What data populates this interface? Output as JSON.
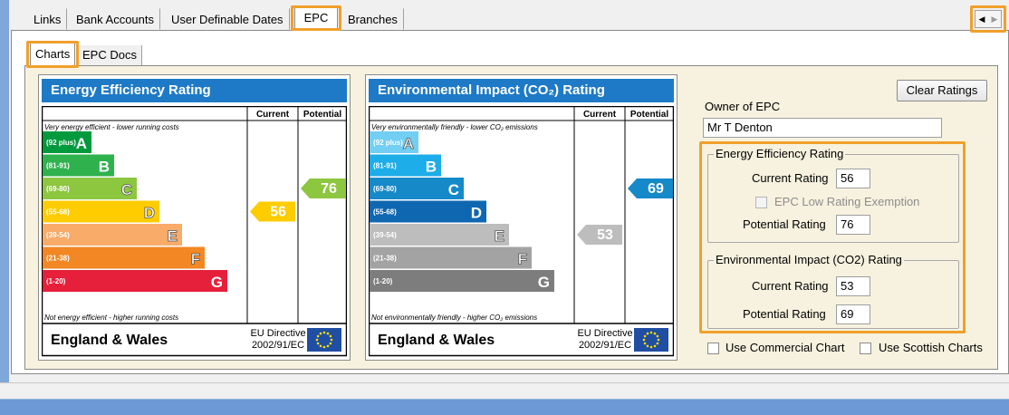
{
  "tabs": [
    "Links",
    "Bank Accounts",
    "User Definable Dates",
    "EPC",
    "Branches"
  ],
  "sub_tabs": [
    "Charts",
    "EPC Docs"
  ],
  "colors": {
    "band_A": "#009a3e",
    "band_B": "#2fb24e",
    "band_C": "#8dc63f",
    "band_D": "#ffcc00",
    "band_E": "#f9ab6a",
    "band_F": "#f28724",
    "band_G": "#e61f3b",
    "env_A": "#72cef2",
    "env_B": "#1dade8",
    "env_C": "#1689c9",
    "env_D": "#0f67b1",
    "env_E": "#bdbdbd",
    "env_F": "#a3a3a3",
    "env_G": "#7d7d7d",
    "title_bar": "#1e7ac6",
    "highlight": "#f0a02c"
  },
  "charts": [
    {
      "title": "Energy Efficiency Rating",
      "col_current": "Current",
      "col_potential": "Potential",
      "top_note": "Very energy efficient - lower running costs",
      "bottom_note": "Not energy efficient - higher running costs",
      "footer_region": "England & Wales",
      "directive_line1": "EU Directive",
      "directive_line2": "2002/91/EC",
      "bands": [
        {
          "range": "(92 plus)",
          "letter": "A",
          "color": "#009a3e"
        },
        {
          "range": "(81-91)",
          "letter": "B",
          "color": "#2fb24e"
        },
        {
          "range": "(69-80)",
          "letter": "C",
          "color": "#8dc63f"
        },
        {
          "range": "(55-68)",
          "letter": "D",
          "color": "#ffcc00"
        },
        {
          "range": "(39-54)",
          "letter": "E",
          "color": "#f9ab6a"
        },
        {
          "range": "(21-38)",
          "letter": "F",
          "color": "#f28724"
        },
        {
          "range": "(1-20)",
          "letter": "G",
          "color": "#e61f3b"
        }
      ],
      "current": {
        "value": 56,
        "band": "D",
        "color": "#ffcc00"
      },
      "potential": {
        "value": 76,
        "band": "C",
        "color": "#8dc63f"
      }
    },
    {
      "title": "Environmental Impact (CO₂) Rating",
      "col_current": "Current",
      "col_potential": "Potential",
      "top_note": "Very environmentally friendly - lower CO₂ emissions",
      "bottom_note": "Not environmentally friendly - higher CO₂ emissions",
      "footer_region": "England & Wales",
      "directive_line1": "EU Directive",
      "directive_line2": "2002/91/EC",
      "bands": [
        {
          "range": "(92 plus)",
          "letter": "A",
          "color": "#72cef2"
        },
        {
          "range": "(81-91)",
          "letter": "B",
          "color": "#1dade8"
        },
        {
          "range": "(69-80)",
          "letter": "C",
          "color": "#1689c9"
        },
        {
          "range": "(55-68)",
          "letter": "D",
          "color": "#0f67b1"
        },
        {
          "range": "(39-54)",
          "letter": "E",
          "color": "#bdbdbd"
        },
        {
          "range": "(21-38)",
          "letter": "F",
          "color": "#a3a3a3"
        },
        {
          "range": "(1-20)",
          "letter": "G",
          "color": "#7d7d7d"
        }
      ],
      "current": {
        "value": 53,
        "band": "E",
        "color": "#bdbdbd"
      },
      "potential": {
        "value": 69,
        "band": "C",
        "color": "#1689c9"
      }
    }
  ],
  "form": {
    "clear_button": "Clear Ratings",
    "owner_label": "Owner of EPC",
    "owner_value": "Mr T Denton",
    "energy_group": "Energy Efficiency Rating",
    "env_group": "Environmental Impact (CO2) Rating",
    "current_label": "Current Rating",
    "potential_label": "Potential Rating",
    "energy_current": "56",
    "energy_potential": "76",
    "exemption_label": "EPC Low Rating Exemption",
    "env_current": "53",
    "env_potential": "69",
    "commercial_label": "Use Commercial Chart",
    "scottish_label": "Use Scottish Charts"
  }
}
